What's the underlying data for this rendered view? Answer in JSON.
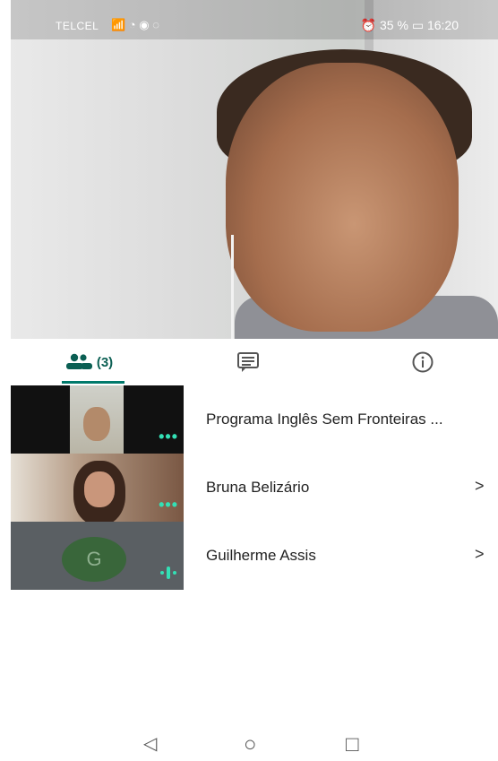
{
  "status_bar": {
    "carrier": "TELCEL",
    "battery": "35 %",
    "time": "16:20"
  },
  "tabs": [
    {
      "name": "participants",
      "count": "(3)",
      "icon": "people-icon"
    },
    {
      "name": "chat",
      "icon": "chat-icon"
    },
    {
      "name": "info",
      "icon": "info-icon"
    }
  ],
  "participants": [
    {
      "name": "Programa Inglês Sem Fronteiras ..."
    },
    {
      "name": "Bruna Belizário",
      "chevron": ">"
    },
    {
      "name": "Guilherme Assis",
      "avatar_letter": "G",
      "chevron": ">"
    }
  ],
  "nav": {
    "back": "◁",
    "home": "○",
    "recents": "□"
  },
  "colors": {
    "accent": "#00796b",
    "status_dots": "#33e0b5",
    "avatar_green": "#39663a"
  }
}
